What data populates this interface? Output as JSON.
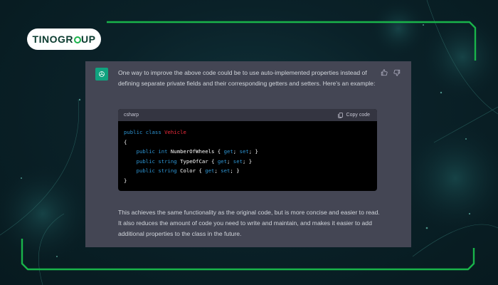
{
  "brand": {
    "logo_left": "TINO",
    "logo_right_g": "GR",
    "logo_right_rest": "UP"
  },
  "message": {
    "intro": "One way to improve the above code could be to use auto-implemented properties instead of defining separate private fields and their corresponding getters and setters. Here's an example:",
    "outro": "This achieves the same functionality as the original code, but is more concise and easier to read. It also reduces the amount of code you need to write and maintain, and makes it easier to add additional properties to the class in the future."
  },
  "code_block": {
    "language": "csharp",
    "copy_label": "Copy code",
    "lines": {
      "l1_kw": "public class ",
      "l1_cls": "Vehicle",
      "l2": "{",
      "l3_indent": "    ",
      "l3_kw": "public int ",
      "l3_name": "NumberOfWheels { ",
      "l3_get": "get",
      "l3_mid": "; ",
      "l3_set": "set",
      "l3_end": "; }",
      "l4_kw": "public string ",
      "l4_name": "TypeOfCar { ",
      "l5_kw": "public string ",
      "l5_name": "Color { ",
      "l6": "}"
    }
  },
  "colors": {
    "accent_green": "#19b34a",
    "panel": "#444654",
    "code_bg": "#000000",
    "keyword": "#2e95d3",
    "class_name": "#f22c3d"
  },
  "icons": {
    "avatar": "openai-logo-icon",
    "thumbs_up": "thumbs-up-icon",
    "thumbs_down": "thumbs-down-icon",
    "copy": "clipboard-icon"
  }
}
